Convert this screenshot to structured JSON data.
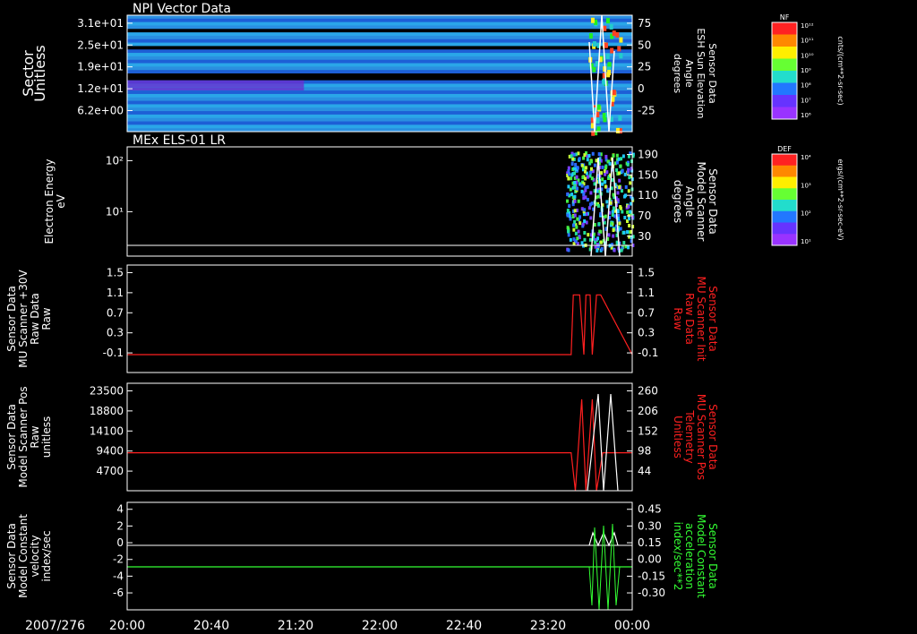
{
  "date_label": "2007/276",
  "time_ticks": [
    "20:00",
    "20:40",
    "21:20",
    "22:00",
    "22:40",
    "23:20",
    "00:00"
  ],
  "colors": {
    "background": "#000000",
    "axis": "#ffffff",
    "red_trace": "#ff2020",
    "green_trace": "#33ff33"
  },
  "colorbars": [
    {
      "id": "nf",
      "title": "NF",
      "units": "cnts/(cm**2-sr-sec)",
      "ticks": [
        "10¹²",
        "10¹¹",
        "10¹⁰",
        "10⁹",
        "10⁸",
        "10⁷",
        "10⁶"
      ]
    },
    {
      "id": "def",
      "title": "DEF",
      "units": "ergs/(cm**2-sr-sec-eV)",
      "ticks": [
        "10⁴",
        "10³",
        "10²",
        "10¹"
      ]
    }
  ],
  "panels": [
    {
      "id": "npi",
      "title": "NPI Vector Data",
      "left_label": [
        "Sector",
        "Unitless"
      ],
      "right_label": [
        "Sensor Data",
        "ESH Sun Elevation",
        "Angle",
        "degrees"
      ],
      "left_ticks": [
        "3.1e+01",
        "2.5e+01",
        "1.9e+01",
        "1.2e+01",
        "6.2e+00"
      ],
      "right_ticks": [
        "75",
        "50",
        "25",
        "0",
        "-25"
      ]
    },
    {
      "id": "els",
      "title": "MEx ELS-01 LR",
      "left_label": [
        "Electron Energy",
        "eV"
      ],
      "right_label": [
        "Sensor Data",
        "Model Scanner",
        "Angle",
        "degrees"
      ],
      "left_ticks": [
        "10²",
        "10¹"
      ],
      "right_ticks": [
        "190",
        "150",
        "110",
        "70",
        "30"
      ]
    },
    {
      "id": "mu_raw",
      "title": "",
      "left_label": [
        "Sensor Data",
        "MU Scanner +30V",
        "Raw Data",
        "Raw"
      ],
      "right_label": [
        "Sensor Data",
        "MU Scanner Init",
        "Raw Data",
        "Raw"
      ],
      "left_ticks": [
        "1.5",
        "1.1",
        "0.7",
        "0.3",
        "-0.1"
      ],
      "right_ticks": [
        "1.5",
        "1.1",
        "0.7",
        "0.3",
        "-0.1"
      ]
    },
    {
      "id": "mu_pos",
      "title": "",
      "left_label": [
        "Sensor Data",
        "Model Scanner Pos",
        "Raw",
        "unitless"
      ],
      "right_label": [
        "Sensor Data",
        "MU Scanner Pos",
        "Telemetry",
        "Unitless"
      ],
      "left_ticks": [
        "23500",
        "18800",
        "14100",
        "9400",
        "4700"
      ],
      "right_ticks": [
        "260",
        "206",
        "152",
        "98",
        "44"
      ]
    },
    {
      "id": "velocity",
      "title": "",
      "left_label": [
        "Sensor Data",
        "Model Constant",
        "velocity",
        "index/sec"
      ],
      "right_label": [
        "Sensor Data",
        "Model Constant",
        "acceleration",
        "index/sec**2"
      ],
      "left_ticks": [
        "4",
        "2",
        "0",
        "-2",
        "-4",
        "-6"
      ],
      "right_ticks": [
        "0.45",
        "0.30",
        "0.15",
        "0.00",
        "-0.15",
        "-0.30"
      ]
    }
  ],
  "chart_data": [
    {
      "type": "heatmap",
      "title": "NPI Vector Data",
      "ylabel": "Sector Unitless",
      "ylim_right": [
        -50,
        75
      ],
      "note": "sector vs time spectrogram with scanner elevation overlay"
    },
    {
      "type": "heatmap",
      "title": "MEx ELS-01 LR",
      "ylabel": "Electron Energy eV",
      "yscale": "log",
      "ylim_right": [
        10,
        190
      ]
    },
    {
      "type": "line",
      "ylim": [
        -0.3,
        1.5
      ],
      "series": [
        {
          "name": "Sensor Data MU Scanner Init Raw Data Raw",
          "x": [
            "20:00",
            "23:31",
            "23:32",
            "23:35",
            "23:37",
            "23:38",
            "23:40",
            "23:41",
            "23:43",
            "23:45",
            "00:00"
          ],
          "values": [
            0,
            0,
            1,
            1,
            0,
            1,
            1,
            0,
            1,
            1,
            0
          ]
        }
      ]
    },
    {
      "type": "line",
      "ylim": [
        0,
        23500
      ],
      "series": [
        {
          "name": "Sensor Data MU Scanner Pos Telemetry Unitless",
          "x": [
            "20:00",
            "23:31",
            "23:33",
            "23:36",
            "23:38",
            "23:41",
            "23:43",
            "23:46",
            "23:48",
            "00:00"
          ],
          "values": [
            8300,
            8300,
            0,
            20000,
            0,
            20000,
            0,
            8300,
            8300,
            8300
          ]
        }
      ]
    },
    {
      "type": "line",
      "ylim": [
        -6,
        4
      ],
      "series": [
        {
          "name": "Sensor Data Model Constant acceleration index/sec**2",
          "x": [
            "20:00",
            "23:31",
            "00:00"
          ],
          "values": [
            -2,
            -2,
            -2
          ]
        }
      ]
    }
  ]
}
